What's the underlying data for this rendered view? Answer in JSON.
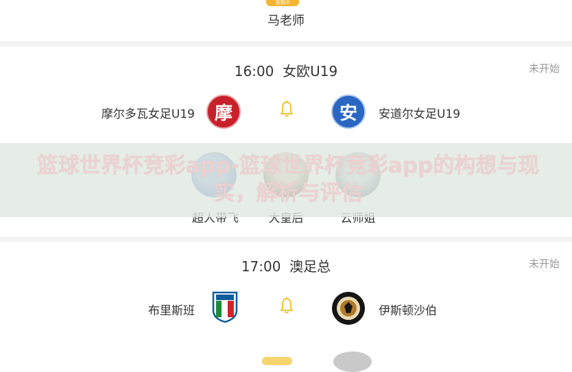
{
  "header": {
    "badge": "竞猜中",
    "expert_name": "马老师"
  },
  "matches": [
    {
      "time": "16:00",
      "league": "女欧U19",
      "status": "未开始",
      "home": {
        "name": "摩尔多瓦女足U19",
        "logo_char": "摩",
        "logo_color": "#c8202b"
      },
      "away": {
        "name": "安道尔女足U19",
        "logo_char": "安",
        "logo_color": "#2a67c2"
      }
    },
    {
      "time": "17:00",
      "league": "澳足总",
      "status": "未开始",
      "home": {
        "name": "布里斯班"
      },
      "away": {
        "name": "伊斯顿沙伯"
      }
    }
  ],
  "experts": [
    {
      "name": "超人带飞"
    },
    {
      "name": "大皇后"
    },
    {
      "name": "云师姐"
    }
  ],
  "overlay": {
    "title": "篮球世界杯竞彩app-篮球世界杯竞彩app的构想与现实，解析与评估"
  },
  "colors": {
    "accent_gold": "#f4b531",
    "bell": "#f2c230",
    "muted": "#999999"
  },
  "icons": {
    "bell": "bell-icon"
  }
}
